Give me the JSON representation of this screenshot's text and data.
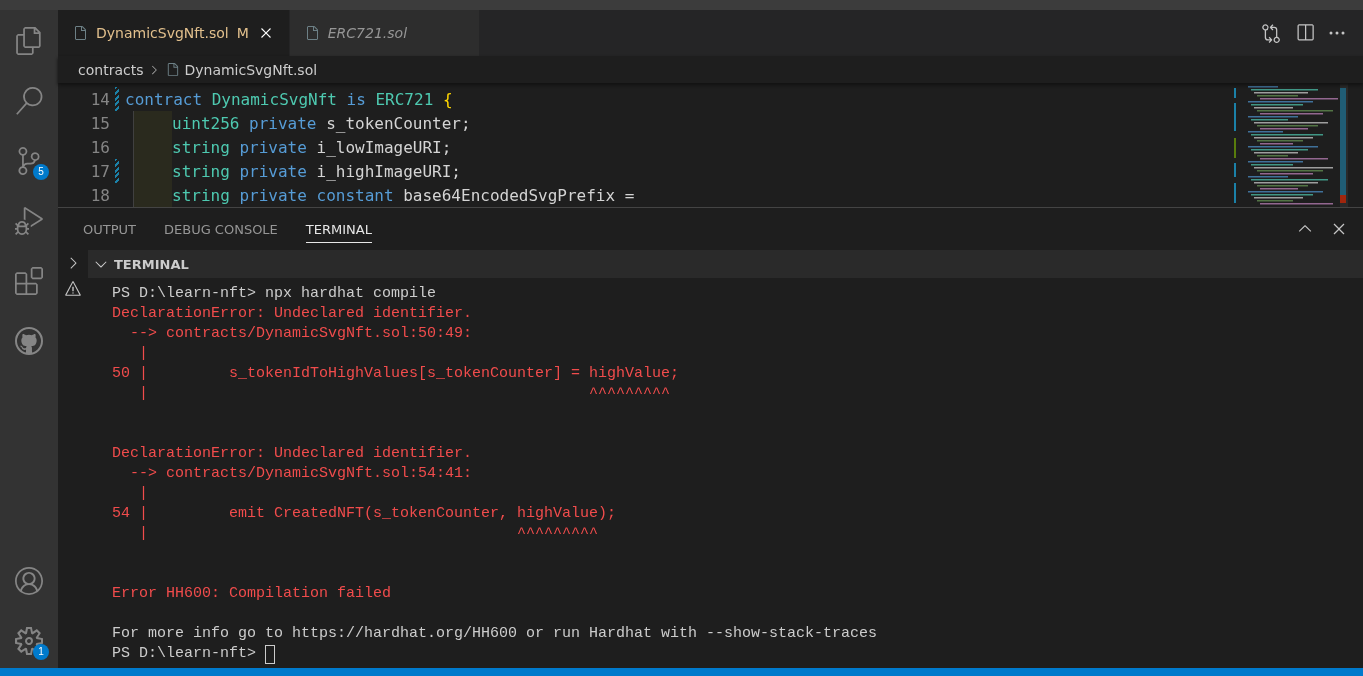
{
  "activity_bar": {
    "items": [
      {
        "kind": "files",
        "selected": false
      },
      {
        "kind": "search",
        "selected": false
      },
      {
        "kind": "scm",
        "selected": false,
        "badge": "5"
      },
      {
        "kind": "debug",
        "selected": false
      },
      {
        "kind": "extensions",
        "selected": false
      },
      {
        "kind": "github",
        "selected": false
      }
    ],
    "bottom": [
      {
        "kind": "account"
      },
      {
        "kind": "settings",
        "badge": "1"
      }
    ]
  },
  "tabs": [
    {
      "label": "DynamicSvgNft.sol",
      "status": "M",
      "selected": true,
      "preview": false
    },
    {
      "label": "ERC721.sol",
      "selected": false,
      "preview": true
    }
  ],
  "breadcrumb": [
    "contracts",
    "DynamicSvgNft.sol"
  ],
  "editor": {
    "lines": [
      {
        "number": "14",
        "modified": true,
        "tokens": [
          {
            "text": "contract ",
            "kind": "keyword"
          },
          {
            "text": "DynamicSvgNft ",
            "kind": "type"
          },
          {
            "text": "is ",
            "kind": "keyword"
          },
          {
            "text": "ERC721 ",
            "kind": "type"
          },
          {
            "text": "{",
            "kind": "bracket"
          }
        ],
        "children": [
          {
            "number": "15",
            "modified": false,
            "tokens": [
              {
                "text": "uint256 ",
                "kind": "type"
              },
              {
                "text": "private ",
                "kind": "keyword"
              },
              {
                "text": "s_tokenCounter;",
                "kind": "plain"
              }
            ]
          },
          {
            "number": "16",
            "modified": false,
            "tokens": [
              {
                "text": "string ",
                "kind": "type"
              },
              {
                "text": "private ",
                "kind": "keyword"
              },
              {
                "text": "i_lowImageURI;",
                "kind": "plain"
              }
            ]
          },
          {
            "number": "17",
            "modified": true,
            "tokens": [
              {
                "text": "string ",
                "kind": "type"
              },
              {
                "text": "private ",
                "kind": "keyword"
              },
              {
                "text": "i_highImageURI;",
                "kind": "plain"
              }
            ]
          },
          {
            "number": "18",
            "modified": false,
            "tokens": [
              {
                "text": "string ",
                "kind": "type"
              },
              {
                "text": "private ",
                "kind": "keyword"
              },
              {
                "text": "constant ",
                "kind": "keyword"
              },
              {
                "text": "base64EncodedSvgPrefix =",
                "kind": "plain"
              }
            ]
          }
        ]
      }
    ]
  },
  "panel": {
    "tabs": [
      {
        "label": "OUTPUT",
        "selected": false
      },
      {
        "label": "DEBUG CONSOLE",
        "selected": false
      },
      {
        "label": "TERMINAL",
        "selected": true
      }
    ],
    "section_title": "TERMINAL",
    "terminal_lines": [
      {
        "kind": "plain",
        "text": "PS D:\\learn-nft> npx hardhat compile"
      },
      {
        "kind": "error",
        "text": "DeclarationError: Undeclared identifier."
      },
      {
        "kind": "error",
        "text": "  --> contracts/DynamicSvgNft.sol:50:49:"
      },
      {
        "kind": "error",
        "text": "   |"
      },
      {
        "kind": "error",
        "text": "50 |         s_tokenIdToHighValues[s_tokenCounter] = highValue;"
      },
      {
        "kind": "error",
        "text": "   |                                                 ^^^^^^^^^"
      },
      {
        "kind": "blank"
      },
      {
        "kind": "blank"
      },
      {
        "kind": "error",
        "text": "DeclarationError: Undeclared identifier."
      },
      {
        "kind": "error",
        "text": "  --> contracts/DynamicSvgNft.sol:54:41:"
      },
      {
        "kind": "error",
        "text": "   |"
      },
      {
        "kind": "error",
        "text": "54 |         emit CreatedNFT(s_tokenCounter, highValue);"
      },
      {
        "kind": "error",
        "text": "   |                                         ^^^^^^^^^"
      },
      {
        "kind": "blank"
      },
      {
        "kind": "blank"
      },
      {
        "kind": "error",
        "text": "Error HH600: Compilation failed"
      },
      {
        "kind": "blank"
      },
      {
        "kind": "plain",
        "text": "For more info go to https://hardhat.org/HH600 or run Hardhat with --show-stack-traces"
      },
      {
        "kind": "prompt",
        "text": "PS D:\\learn-nft> "
      }
    ]
  }
}
